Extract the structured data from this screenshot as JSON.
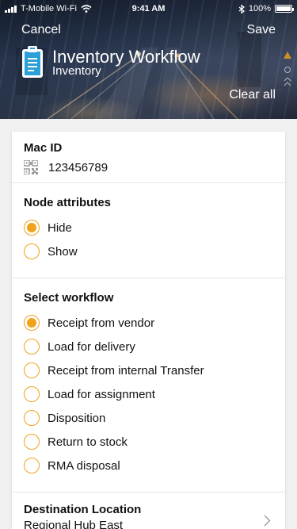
{
  "status_bar": {
    "carrier": "T-Mobile Wi-Fi",
    "time": "9:41 AM",
    "battery_percent": "100%",
    "battery_level": 1.0
  },
  "nav": {
    "cancel_label": "Cancel",
    "save_label": "Save",
    "title": "Inventory Workflow",
    "subtitle": "Inventory",
    "clear_all_label": "Clear all"
  },
  "mac": {
    "label": "Mac ID",
    "value": "123456789",
    "icon": "qr-code-icon"
  },
  "node_attributes": {
    "label": "Node attributes",
    "options": [
      {
        "label": "Hide",
        "selected": true
      },
      {
        "label": "Show",
        "selected": false
      }
    ]
  },
  "workflow": {
    "label": "Select workflow",
    "options": [
      {
        "label": "Receipt from vendor",
        "selected": true
      },
      {
        "label": "Load for delivery",
        "selected": false
      },
      {
        "label": "Receipt from internal Transfer",
        "selected": false
      },
      {
        "label": "Load for assignment",
        "selected": false
      },
      {
        "label": "Disposition",
        "selected": false
      },
      {
        "label": "Return to stock",
        "selected": false
      },
      {
        "label": "RMA disposal",
        "selected": false
      }
    ]
  },
  "destination": {
    "label": "Destination Location",
    "value": "Regional Hub East"
  },
  "colors": {
    "accent": "#f0a21b",
    "clipboard_blue": "#2a9fd8"
  }
}
